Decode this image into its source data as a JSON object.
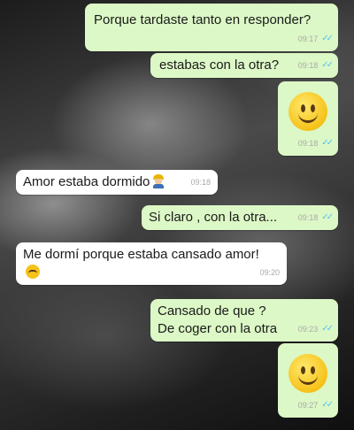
{
  "messages": [
    {
      "text": "Porque tardaste tanto en responder?",
      "time": "09:17",
      "ticks": "✓✓"
    },
    {
      "text": "estabas con la otra?",
      "time": "09:18",
      "ticks": "✓✓"
    },
    {
      "emoji": "slightly-smiling-face",
      "time": "09:18",
      "ticks": "✓✓"
    },
    {
      "text": "Amor estaba dormido",
      "emoji": "construction-worker",
      "time": "09:18"
    },
    {
      "text": "Si claro , con la otra...",
      "time": "09:18",
      "ticks": "✓✓"
    },
    {
      "text": "Me dormí porque estaba cansado amor!",
      "emoji": "unamused-face",
      "time": "09:20"
    },
    {
      "text": "Cansado de que ?\nDe coger con la otra",
      "time": "09:23",
      "ticks": "✓✓"
    },
    {
      "emoji": "slightly-smiling-face",
      "time": "09:27",
      "ticks": "✓✓"
    }
  ],
  "colors": {
    "outgoing": "#dcf8c6",
    "incoming": "#ffffff",
    "read_ticks": "#4fc3f7"
  }
}
